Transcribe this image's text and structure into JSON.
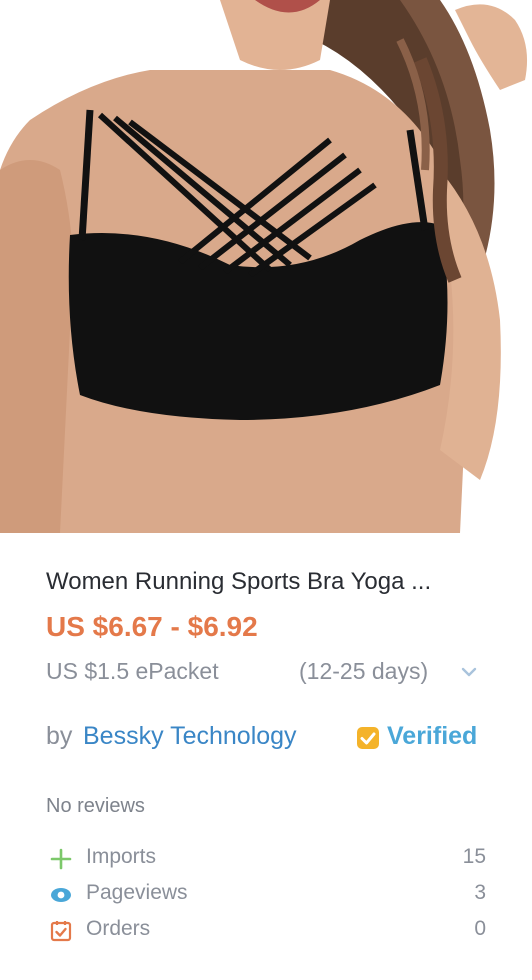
{
  "product": {
    "title": "Women Running Sports Bra Yoga ...",
    "price": "US $6.67 - $6.92",
    "shipping_cost": "US $1.5 ePacket",
    "shipping_days": "(12-25 days)"
  },
  "seller": {
    "by_label": "by",
    "name": "Bessky Technology",
    "verified_label": "Verified"
  },
  "reviews": {
    "text": "No reviews"
  },
  "stats": [
    {
      "icon": "plus-icon",
      "label": "Imports",
      "value": "15"
    },
    {
      "icon": "eye-icon",
      "label": "Pageviews",
      "value": "3"
    },
    {
      "icon": "checkbox-icon",
      "label": "Orders",
      "value": "0"
    }
  ],
  "colors": {
    "price": "#e4794a",
    "link": "#3a86c6",
    "verified_badge": "#f4b32a",
    "verified_text": "#4aa7d8",
    "plus_icon": "#7cc86a",
    "eye_icon": "#4aa7d8",
    "orders_icon": "#e4794a"
  }
}
